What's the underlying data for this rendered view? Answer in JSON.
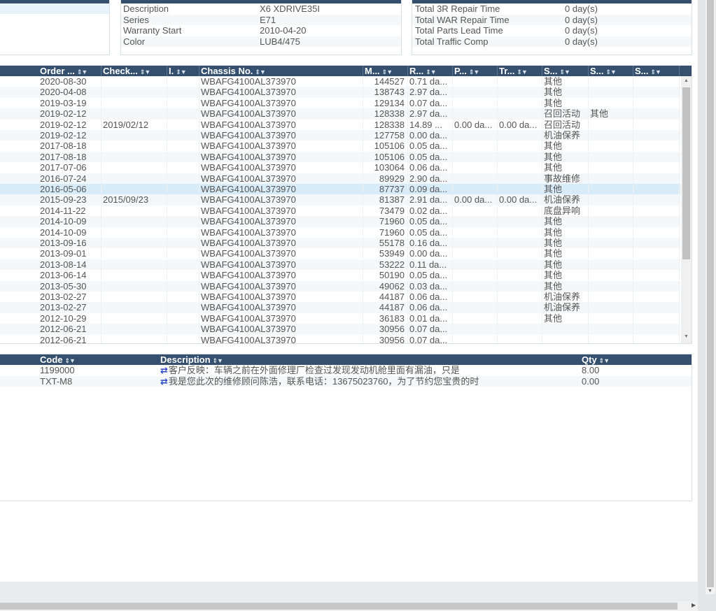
{
  "vehicle": {
    "rows": [
      {
        "key": "Description",
        "value": "X6 XDRIVE35I"
      },
      {
        "key": "Series",
        "value": "E71"
      },
      {
        "key": "Warranty Start",
        "value": "2010-04-20"
      },
      {
        "key": "Color",
        "value": "LUB4/475"
      }
    ]
  },
  "totals": {
    "rows": [
      {
        "key": "Total 3R Repair Time",
        "value": "0 day(s)"
      },
      {
        "key": "Total WAR Repair Time",
        "value": "0 day(s)"
      },
      {
        "key": "Total Parts Lead Time",
        "value": "0 day(s)"
      },
      {
        "key": "Total Traffic Comp",
        "value": "0 day(s)"
      }
    ]
  },
  "orders": {
    "columns": [
      "Order ...",
      "Check...",
      "I.",
      "Chassis No.",
      "M...",
      "R...",
      "P...",
      "Tr...",
      "S...",
      "S...",
      "S..."
    ],
    "rows": [
      [
        "2020-08-30",
        "",
        "",
        "WBAFG4100AL373970",
        "144527",
        "0.71 da...",
        "",
        "",
        "其他",
        "",
        ""
      ],
      [
        "2020-04-08",
        "",
        "",
        "WBAFG4100AL373970",
        "138743",
        "2.97 da...",
        "",
        "",
        "其他",
        "",
        ""
      ],
      [
        "2019-03-19",
        "",
        "",
        "WBAFG4100AL373970",
        "129134",
        "0.07 da...",
        "",
        "",
        "其他",
        "",
        ""
      ],
      [
        "2019-02-12",
        "",
        "",
        "WBAFG4100AL373970",
        "128338",
        "2.97 da...",
        "",
        "",
        "召回活动",
        "其他",
        ""
      ],
      [
        "2019-02-12",
        "2019/02/12",
        "",
        "WBAFG4100AL373970",
        "128338",
        "14.89 ...",
        "0.00 da...",
        "0.00 da...",
        "召回活动",
        "",
        ""
      ],
      [
        "2019-02-12",
        "",
        "",
        "WBAFG4100AL373970",
        "127758",
        "0.00 da...",
        "",
        "",
        "机油保养",
        "",
        ""
      ],
      [
        "2017-08-18",
        "",
        "",
        "WBAFG4100AL373970",
        "105106",
        "0.05 da...",
        "",
        "",
        "其他",
        "",
        ""
      ],
      [
        "2017-08-18",
        "",
        "",
        "WBAFG4100AL373970",
        "105106",
        "0.05 da...",
        "",
        "",
        "其他",
        "",
        ""
      ],
      [
        "2017-07-06",
        "",
        "",
        "WBAFG4100AL373970",
        "103064",
        "0.06 da...",
        "",
        "",
        "其他",
        "",
        ""
      ],
      [
        "2016-07-24",
        "",
        "",
        "WBAFG4100AL373970",
        "89929",
        "2.90 da...",
        "",
        "",
        "事故维修",
        "",
        ""
      ],
      [
        "2016-05-06",
        "",
        "",
        "WBAFG4100AL373970",
        "87737",
        "0.09 da...",
        "",
        "",
        "其他",
        "",
        ""
      ],
      [
        "2015-09-23",
        "2015/09/23",
        "",
        "WBAFG4100AL373970",
        "81387",
        "2.91 da...",
        "0.00 da...",
        "0.00 da...",
        "机油保养",
        "",
        ""
      ],
      [
        "2014-11-22",
        "",
        "",
        "WBAFG4100AL373970",
        "73479",
        "0.02 da...",
        "",
        "",
        "底盘异响",
        "",
        ""
      ],
      [
        "2014-10-09",
        "",
        "",
        "WBAFG4100AL373970",
        "71960",
        "0.05 da...",
        "",
        "",
        "其他",
        "",
        ""
      ],
      [
        "2014-10-09",
        "",
        "",
        "WBAFG4100AL373970",
        "71960",
        "0.05 da...",
        "",
        "",
        "其他",
        "",
        ""
      ],
      [
        "2013-09-16",
        "",
        "",
        "WBAFG4100AL373970",
        "55178",
        "0.16 da...",
        "",
        "",
        "其他",
        "",
        ""
      ],
      [
        "2013-09-01",
        "",
        "",
        "WBAFG4100AL373970",
        "53949",
        "0.00 da...",
        "",
        "",
        "其他",
        "",
        ""
      ],
      [
        "2013-08-14",
        "",
        "",
        "WBAFG4100AL373970",
        "53222",
        "0.11 da...",
        "",
        "",
        "其他",
        "",
        ""
      ],
      [
        "2013-06-14",
        "",
        "",
        "WBAFG4100AL373970",
        "50190",
        "0.05 da...",
        "",
        "",
        "其他",
        "",
        ""
      ],
      [
        "2013-05-30",
        "",
        "",
        "WBAFG4100AL373970",
        "49062",
        "0.03 da...",
        "",
        "",
        "其他",
        "",
        ""
      ],
      [
        "2013-02-27",
        "",
        "",
        "WBAFG4100AL373970",
        "44187",
        "0.06 da...",
        "",
        "",
        "机油保养",
        "",
        ""
      ],
      [
        "2013-02-27",
        "",
        "",
        "WBAFG4100AL373970",
        "44187",
        "0.06 da...",
        "",
        "",
        "机油保养",
        "",
        ""
      ],
      [
        "2012-10-29",
        "",
        "",
        "WBAFG4100AL373970",
        "36183",
        "0.01 da...",
        "",
        "",
        "其他",
        "",
        ""
      ],
      [
        "2012-06-21",
        "",
        "",
        "WBAFG4100AL373970",
        "30956",
        "0.07 da...",
        "",
        "",
        "",
        "",
        ""
      ],
      [
        "2012-06-21",
        "",
        "",
        "WBAFG4100AL373970",
        "30956",
        "0.07 da...",
        "",
        "",
        "",
        "",
        ""
      ]
    ],
    "selected_row": 10
  },
  "details": {
    "columns": [
      "Code",
      "Description",
      "Qty"
    ],
    "rows": [
      [
        "1199000",
        "客户反映：车辆之前在外面修理厂检查过发现发动机舱里面有漏油，只是",
        "8.00"
      ],
      [
        "TXT-M8",
        "我是您此次的维修顾问陈浩，联系电话：13675023760，为了节约您宝贵的时",
        "0.00"
      ]
    ]
  },
  "icons": {
    "sort": "sort-filter-icon",
    "link": "swap-arrows-icon"
  },
  "colors": {
    "header_bg": "#34506e",
    "selected_row": "#d7ebf8",
    "alt_row": "#f4f8fb",
    "link_icon": "#2a45c6"
  }
}
